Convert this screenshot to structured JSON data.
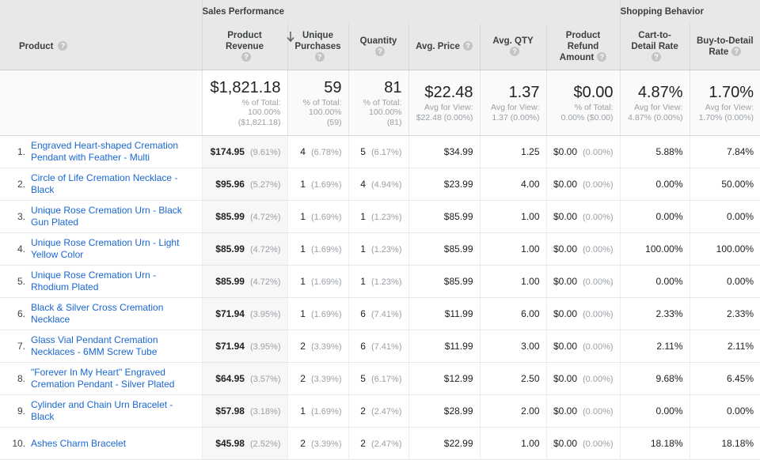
{
  "groups": [
    {
      "label": "",
      "span": 1
    },
    {
      "label": "Sales Performance",
      "span": 6
    },
    {
      "label": "Shopping Behavior",
      "span": 2
    }
  ],
  "columns": [
    {
      "key": "product",
      "label": "Product",
      "help": "?",
      "sorted": false
    },
    {
      "key": "revenue",
      "label": "Product Revenue",
      "help": "?",
      "sorted": true,
      "sort_dir": "desc"
    },
    {
      "key": "unique_purchases",
      "label": "Unique Purchases",
      "help": "?",
      "sorted": false
    },
    {
      "key": "quantity",
      "label": "Quantity",
      "help": "?",
      "sorted": false
    },
    {
      "key": "avg_price",
      "label": "Avg. Price",
      "help": "?",
      "sorted": false
    },
    {
      "key": "avg_qty",
      "label": "Avg. QTY",
      "help": "?",
      "sorted": false
    },
    {
      "key": "refund",
      "label": "Product Refund Amount",
      "help": "?",
      "sorted": false
    },
    {
      "key": "cart_to_detail",
      "label": "Cart-to-Detail Rate",
      "help": "?",
      "sorted": false
    },
    {
      "key": "buy_to_detail",
      "label": "Buy-to-Detail Rate",
      "help": "?",
      "sorted": false
    }
  ],
  "totals": {
    "revenue": {
      "value": "$1,821.18",
      "sub": "% of Total: 100.00% ($1,821.18)"
    },
    "unique_purchases": {
      "value": "59",
      "sub": "% of Total: 100.00% (59)"
    },
    "quantity": {
      "value": "81",
      "sub": "% of Total: 100.00% (81)"
    },
    "avg_price": {
      "value": "$22.48",
      "sub": "Avg for View: $22.48 (0.00%)"
    },
    "avg_qty": {
      "value": "1.37",
      "sub": "Avg for View: 1.37 (0.00%)"
    },
    "refund": {
      "value": "$0.00",
      "sub": "% of Total: 0.00% ($0.00)"
    },
    "cart_to_detail": {
      "value": "4.87%",
      "sub": "Avg for View: 4.87% (0.00%)"
    },
    "buy_to_detail": {
      "value": "1.70%",
      "sub": "Avg for View: 1.70% (0.00%)"
    }
  },
  "rows": [
    {
      "index": "1.",
      "product": "Engraved Heart-shaped Cremation Pendant with Feather - Multi",
      "revenue": "$174.95",
      "revenue_pct": "(9.61%)",
      "unique_purchases": "4",
      "unique_purchases_pct": "(6.78%)",
      "quantity": "5",
      "quantity_pct": "(6.17%)",
      "avg_price": "$34.99",
      "avg_qty": "1.25",
      "refund": "$0.00",
      "refund_pct": "(0.00%)",
      "cart_to_detail": "5.88%",
      "buy_to_detail": "7.84%"
    },
    {
      "index": "2.",
      "product": "Circle of Life Cremation Necklace - Black",
      "revenue": "$95.96",
      "revenue_pct": "(5.27%)",
      "unique_purchases": "1",
      "unique_purchases_pct": "(1.69%)",
      "quantity": "4",
      "quantity_pct": "(4.94%)",
      "avg_price": "$23.99",
      "avg_qty": "4.00",
      "refund": "$0.00",
      "refund_pct": "(0.00%)",
      "cart_to_detail": "0.00%",
      "buy_to_detail": "50.00%"
    },
    {
      "index": "3.",
      "product": "Unique Rose Cremation Urn - Black Gun Plated",
      "revenue": "$85.99",
      "revenue_pct": "(4.72%)",
      "unique_purchases": "1",
      "unique_purchases_pct": "(1.69%)",
      "quantity": "1",
      "quantity_pct": "(1.23%)",
      "avg_price": "$85.99",
      "avg_qty": "1.00",
      "refund": "$0.00",
      "refund_pct": "(0.00%)",
      "cart_to_detail": "0.00%",
      "buy_to_detail": "0.00%"
    },
    {
      "index": "4.",
      "product": "Unique Rose Cremation Urn - Light Yellow Color",
      "revenue": "$85.99",
      "revenue_pct": "(4.72%)",
      "unique_purchases": "1",
      "unique_purchases_pct": "(1.69%)",
      "quantity": "1",
      "quantity_pct": "(1.23%)",
      "avg_price": "$85.99",
      "avg_qty": "1.00",
      "refund": "$0.00",
      "refund_pct": "(0.00%)",
      "cart_to_detail": "100.00%",
      "buy_to_detail": "100.00%"
    },
    {
      "index": "5.",
      "product": "Unique Rose Cremation Urn - Rhodium Plated",
      "revenue": "$85.99",
      "revenue_pct": "(4.72%)",
      "unique_purchases": "1",
      "unique_purchases_pct": "(1.69%)",
      "quantity": "1",
      "quantity_pct": "(1.23%)",
      "avg_price": "$85.99",
      "avg_qty": "1.00",
      "refund": "$0.00",
      "refund_pct": "(0.00%)",
      "cart_to_detail": "0.00%",
      "buy_to_detail": "0.00%"
    },
    {
      "index": "6.",
      "product": "Black & Silver Cross Cremation Necklace",
      "revenue": "$71.94",
      "revenue_pct": "(3.95%)",
      "unique_purchases": "1",
      "unique_purchases_pct": "(1.69%)",
      "quantity": "6",
      "quantity_pct": "(7.41%)",
      "avg_price": "$11.99",
      "avg_qty": "6.00",
      "refund": "$0.00",
      "refund_pct": "(0.00%)",
      "cart_to_detail": "2.33%",
      "buy_to_detail": "2.33%"
    },
    {
      "index": "7.",
      "product": "Glass Vial Pendant Cremation Necklaces - 6MM Screw Tube",
      "revenue": "$71.94",
      "revenue_pct": "(3.95%)",
      "unique_purchases": "2",
      "unique_purchases_pct": "(3.39%)",
      "quantity": "6",
      "quantity_pct": "(7.41%)",
      "avg_price": "$11.99",
      "avg_qty": "3.00",
      "refund": "$0.00",
      "refund_pct": "(0.00%)",
      "cart_to_detail": "2.11%",
      "buy_to_detail": "2.11%"
    },
    {
      "index": "8.",
      "product": "\"Forever In My Heart\" Engraved Cremation Pendant - Silver Plated",
      "revenue": "$64.95",
      "revenue_pct": "(3.57%)",
      "unique_purchases": "2",
      "unique_purchases_pct": "(3.39%)",
      "quantity": "5",
      "quantity_pct": "(6.17%)",
      "avg_price": "$12.99",
      "avg_qty": "2.50",
      "refund": "$0.00",
      "refund_pct": "(0.00%)",
      "cart_to_detail": "9.68%",
      "buy_to_detail": "6.45%"
    },
    {
      "index": "9.",
      "product": "Cylinder and Chain Urn Bracelet - Black",
      "revenue": "$57.98",
      "revenue_pct": "(3.18%)",
      "unique_purchases": "1",
      "unique_purchases_pct": "(1.69%)",
      "quantity": "2",
      "quantity_pct": "(2.47%)",
      "avg_price": "$28.99",
      "avg_qty": "2.00",
      "refund": "$0.00",
      "refund_pct": "(0.00%)",
      "cart_to_detail": "0.00%",
      "buy_to_detail": "0.00%"
    },
    {
      "index": "10.",
      "product": "Ashes Charm Bracelet",
      "revenue": "$45.98",
      "revenue_pct": "(2.52%)",
      "unique_purchases": "2",
      "unique_purchases_pct": "(3.39%)",
      "quantity": "2",
      "quantity_pct": "(2.47%)",
      "avg_price": "$22.99",
      "avg_qty": "1.00",
      "refund": "$0.00",
      "refund_pct": "(0.00%)",
      "cart_to_detail": "18.18%",
      "buy_to_detail": "18.18%"
    }
  ],
  "colors": {
    "link": "#1967d2",
    "header_bg": "#e8e8e8",
    "muted": "#9aa0a6",
    "sorted_bg": "#f7f7f7"
  }
}
